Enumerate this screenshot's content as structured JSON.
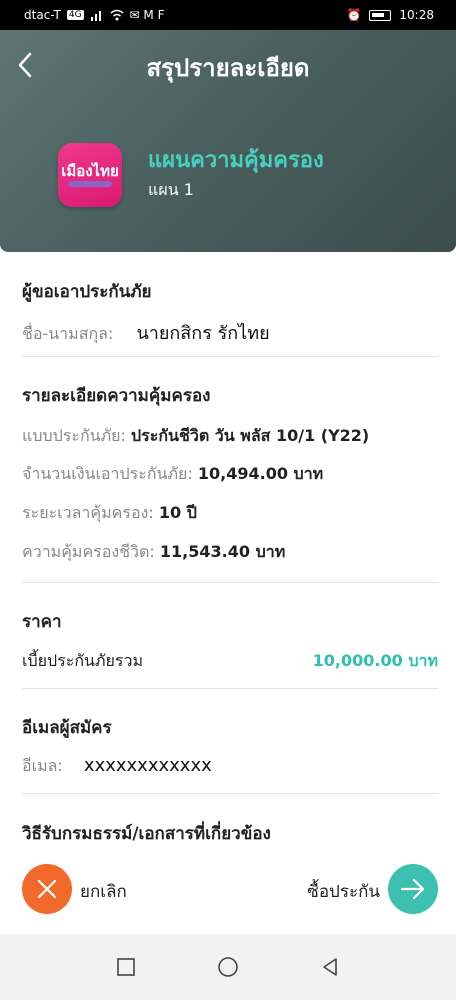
{
  "status_bar": {
    "carrier": "dtac-T",
    "network": "4G",
    "icons_left": "signal-wifi-K+-mail",
    "battery_level": "80",
    "time": "10:28"
  },
  "header": {
    "title": "สรุปรายละเอียด",
    "logo_text": "เมืองไทย",
    "plan_name": "แผนความคุ้มครอง",
    "plan_sub": "แผน 1",
    "bg_color": "#4b6060"
  },
  "applicant": {
    "section_title": "ผู้ขอเอาประกันภัย",
    "name_label": "ชื่อ-นามสกุล:",
    "name_value": "นายกสิกร รักไทย"
  },
  "coverage": {
    "section_title": "รายละเอียดความคุ้มครอง",
    "rows": [
      {
        "label": "แบบประกันภัย:",
        "value": "ประกันชีวิต วัน พลัส 10/1 (Y22)"
      },
      {
        "label": "จำนวนเงินเอาประกันภัย:",
        "value": "10,494.00 บาท"
      },
      {
        "label": "ระยะเวลาคุ้มครอง:",
        "value": "10 ปี"
      },
      {
        "label": "ความคุ้มครองชีวิต:",
        "value": "11,543.40 บาท"
      }
    ]
  },
  "price": {
    "section_title": "ราคา",
    "label": "เบี้ยประกันภัยรวม",
    "value": "10,000.00 บาท",
    "accent_color": "#2fbfae"
  },
  "email": {
    "section_title": "อีเมลผู้สมัคร",
    "label": "อีเมล:",
    "value": "xxxxxxxxxxxx"
  },
  "documents": {
    "section_title": "วิธีรับกรมธรรม์/เอกสารที่เกี่ยวข้อง"
  },
  "actions": {
    "cancel_label": "ยกเลิก",
    "cancel_color": "#f26a2b",
    "buy_label": "ซื้อประกัน",
    "buy_color": "#3dc0b0"
  },
  "nav": {
    "icons": [
      "recent-apps-icon",
      "home-icon",
      "back-icon"
    ]
  }
}
